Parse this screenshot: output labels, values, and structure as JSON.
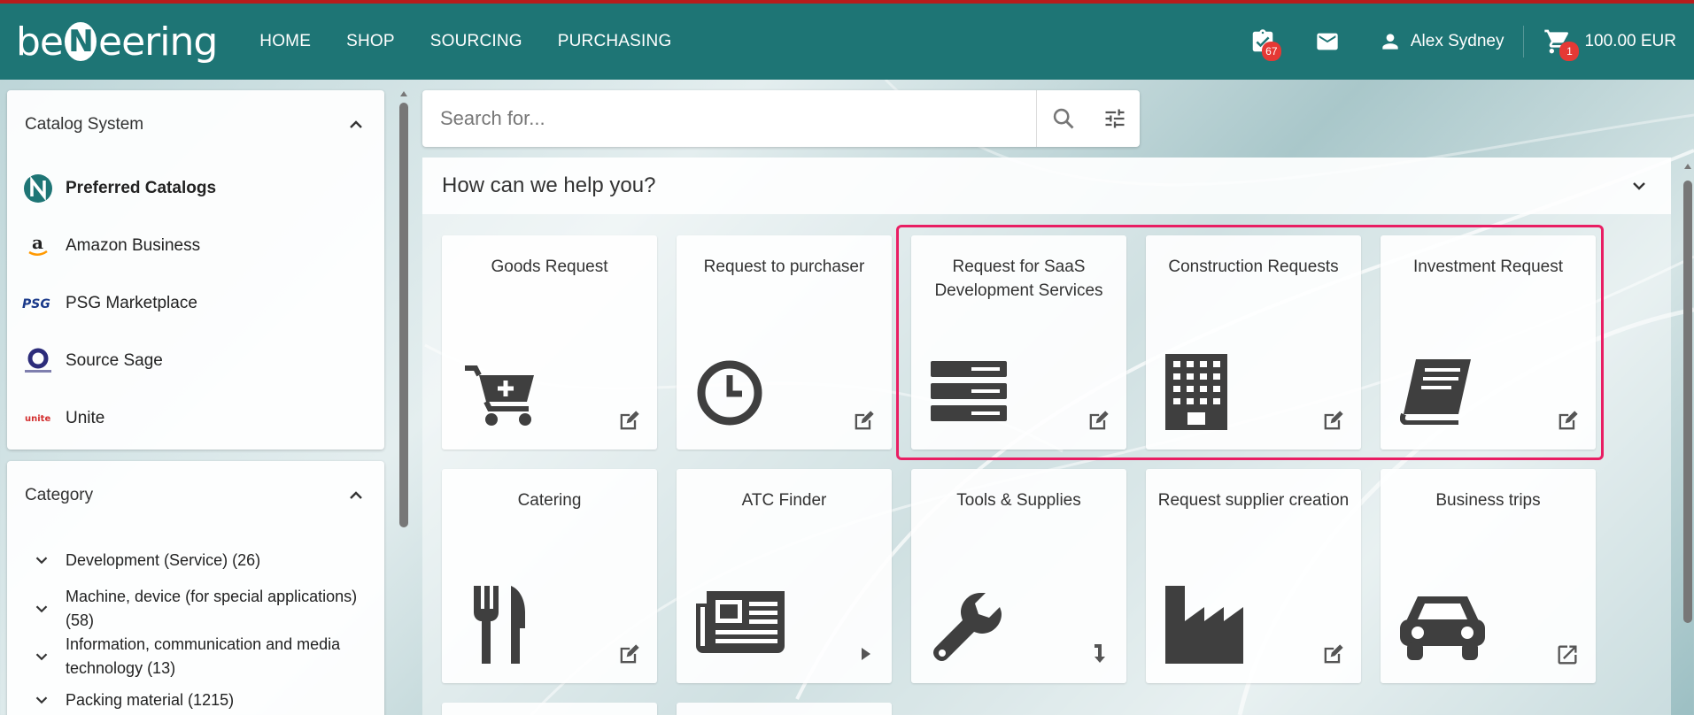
{
  "header": {
    "logo_text": [
      "be",
      "N",
      "eering"
    ],
    "nav": [
      "HOME",
      "SHOP",
      "SOURCING",
      "PURCHASING"
    ],
    "tasks_badge": "67",
    "user_name": "Alex Sydney",
    "cart_badge": "1",
    "cart_amount": "100.00 EUR"
  },
  "catalog_panel": {
    "title": "Catalog System",
    "items": [
      {
        "label": "Preferred Catalogs",
        "icon": "nerring-logo-icon",
        "active": true
      },
      {
        "label": "Amazon Business",
        "icon": "amazon-logo-icon"
      },
      {
        "label": "PSG Marketplace",
        "icon": "psg-logo-icon"
      },
      {
        "label": "Source Sage",
        "icon": "sourcesage-logo-icon"
      },
      {
        "label": "Unite",
        "icon": "unite-logo-icon"
      }
    ]
  },
  "category_panel": {
    "title": "Category",
    "items": [
      {
        "label": "Development (Service) (26)"
      },
      {
        "label": "Machine, device (for special applications) (58)"
      },
      {
        "label": "Information, communication and media technology (13)"
      },
      {
        "label": "Packing material (1215)"
      }
    ]
  },
  "search": {
    "placeholder": "Search for..."
  },
  "help": {
    "title": "How can we help you?",
    "tiles": [
      {
        "title": "Goods Request",
        "icon": "cart-plus-icon",
        "action": "edit-icon"
      },
      {
        "title": "Request to purchaser",
        "icon": "clock-icon",
        "action": "edit-icon"
      },
      {
        "title": "Request for SaaS Development Services",
        "icon": "server-icon",
        "action": "edit-icon"
      },
      {
        "title": "Construction Requests",
        "icon": "building-icon",
        "action": "edit-icon"
      },
      {
        "title": "Investment Request",
        "icon": "book-icon",
        "action": "edit-icon"
      },
      {
        "title": "Catering",
        "icon": "cutlery-icon",
        "action": "edit-icon"
      },
      {
        "title": "ATC Finder",
        "icon": "newspaper-icon",
        "action": "play-icon"
      },
      {
        "title": "Tools & Supplies",
        "icon": "wrench-icon",
        "action": "arrow-down-icon"
      },
      {
        "title": "Request supplier creation",
        "icon": "factory-icon",
        "action": "edit-icon"
      },
      {
        "title": "Business trips",
        "icon": "car-icon",
        "action": "external-link-icon"
      }
    ]
  },
  "colors": {
    "header": "#1e7575",
    "top_line": "#b71c1c",
    "badge": "#e53935",
    "highlight": "#e91e63",
    "icon": "#3f3f3f"
  }
}
